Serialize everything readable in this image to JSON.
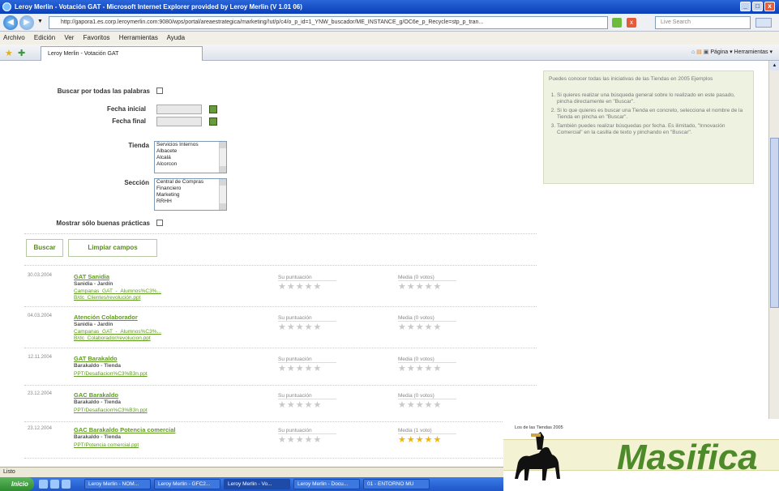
{
  "window": {
    "title": "Leroy Merlin - Votación GAT - Microsoft Internet Explorer provided by Leroy Merlin (V 1.01 06)"
  },
  "addressbar": {
    "url": "http://gapora1.es.corp.leroymerlin.com:9080/wps/portal/areaestrategica/marketing/!ut/p/c4/o_p_id=1_YNW_buscador/ME_INSTANCE_g/OC6e_p_Recycle=stp_p_tran...",
    "search_placeholder": "Live Search"
  },
  "menu": {
    "items": [
      "Archivo",
      "Edición",
      "Ver",
      "Favoritos",
      "Herramientas",
      "Ayuda"
    ]
  },
  "tab": {
    "title": "Leroy Merlin - Votación GAT",
    "commands": "Página ▾   Herramientas ▾"
  },
  "form": {
    "buscar_label": "Buscar por todas las palabras",
    "fecha_inicial_label": "Fecha inicial",
    "fecha_final_label": "Fecha final",
    "tienda_label": "Tienda",
    "tienda_options": [
      "Servicios Internos",
      "Albacete",
      "Alcalá",
      "Alcorcon"
    ],
    "seccion_label": "Sección",
    "seccion_options": [
      "Central de Compras",
      "Financiero",
      "Marketing",
      "RRHH"
    ],
    "mostrar_label": "Mostrar sólo buenas prácticas",
    "buscar_button": "Buscar",
    "limpiar_button": "Limpiar campos"
  },
  "info": {
    "heading": "Puedes conocer todas las iniciativas de las Tiendas en 2005 Ejemplos",
    "items": [
      "Si quieres realizar una búsqueda general sobre lo realizado en este pasado, pincha directamente en \"Buscar\".",
      "Si lo que quieres es buscar una Tienda en concreto, selecciona el nombre de la Tienda en pincha en \"Buscar\".",
      "También puedes realizar búsquedas por fecha. Es ilimitado, \"Innovación Comercial\" en la casilla de texto y pinchando en \"Buscar\"."
    ]
  },
  "results": [
    {
      "date": "30.03.2004",
      "title": "GAT Sanidia",
      "subtitle": "Sanidia - Jardín",
      "links": [
        "Campanas_GAT_-_Alumnos%C3%...",
        "B/dc_Clientes/revolución.ppt"
      ],
      "puntuacion_label": "Su puntuación",
      "media_label": "Media (0 votos)",
      "media_stars": 0
    },
    {
      "date": "04.03.2004",
      "title": "Atención Colaborador",
      "subtitle": "Sanidia - Jardín",
      "links": [
        "Campanas_GAT_-_Alumnos%C3%...",
        "B/dc_Colaborador/revolucion.ppt"
      ],
      "puntuacion_label": "Su puntuación",
      "media_label": "Media (0 votos)",
      "media_stars": 0
    },
    {
      "date": "12.11.2004",
      "title": "GAT Barakaldo",
      "subtitle": "Barakaldo - Tienda",
      "links": [
        "PPT/Desafiacion%C3%B3n.ppt"
      ],
      "puntuacion_label": "Su puntuación",
      "media_label": "Media (0 votos)",
      "media_stars": 0
    },
    {
      "date": "23.12.2004",
      "title": "GAC Barakaldo",
      "subtitle": "Barakaldo - Tienda",
      "links": [
        "PPT/Desafiacion%C3%B3n.ppt"
      ],
      "puntuacion_label": "Su puntuación",
      "media_label": "Media (0 votos)",
      "media_stars": 0
    },
    {
      "date": "23.12.2004",
      "title": "GAC Barakaldo Potencia comercial",
      "subtitle": "Barakaldo - Tienda",
      "links": [
        "PPT/Potencia comercial.ppt"
      ],
      "puntuacion_label": "Su puntuación",
      "media_label": "Media (1 voto)",
      "media_stars": 5
    }
  ],
  "status": {
    "text": "Listo"
  },
  "taskbar": {
    "start": "Inicio",
    "buttons": [
      "Leroy Merlin - NOM...",
      "Leroy Merlin - GFC2...",
      "Leroy Merlin - Vo...",
      "Leroy Merlin - Docu...",
      "01 - ENTORNO MU"
    ]
  },
  "logo": {
    "word": "Masifica",
    "tagline": "Los de las Tiendas 2005"
  },
  "colors": {
    "accent": "#5f9b1f",
    "star_gold": "#f1b40d",
    "titlebar": "#0a3fb8"
  }
}
